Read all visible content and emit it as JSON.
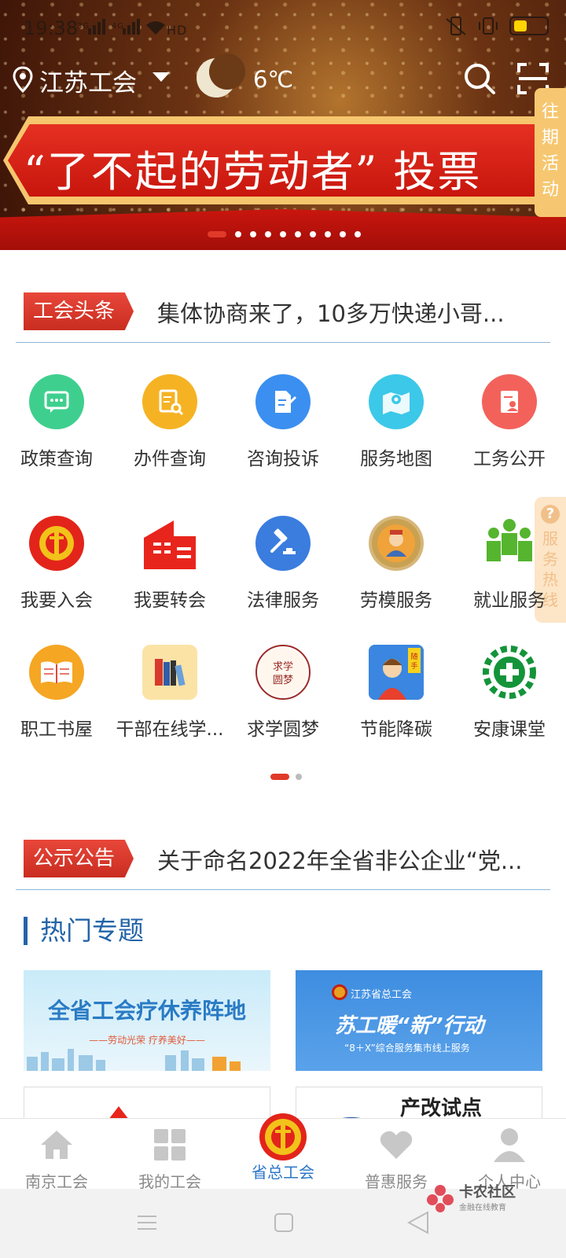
{
  "status_bar": {
    "time": "19:38",
    "network": "3G 4G HD"
  },
  "header": {
    "location": "江苏工会",
    "temperature": "6℃"
  },
  "banner": {
    "text": "“了不起的劳动者” 投票",
    "slide_count": 10,
    "active_slide": 1
  },
  "side_tabs": {
    "past_events": "往期活动",
    "hotline": "服务热线",
    "hotline_icon": "?"
  },
  "news_strip_1": {
    "tag": "工会头条",
    "text": "集体协商来了，10多万快递小哥..."
  },
  "grid": {
    "row1": [
      {
        "label": "政策查询",
        "icon": "chat-icon",
        "color": "#3ecf8e"
      },
      {
        "label": "办件查询",
        "icon": "doc-search-icon",
        "color": "#f5b324"
      },
      {
        "label": "咨询投诉",
        "icon": "edit-doc-icon",
        "color": "#3b8ff0"
      },
      {
        "label": "服务地图",
        "icon": "map-pin-icon",
        "color": "#3cc8e8"
      },
      {
        "label": "工务公开",
        "icon": "person-doc-icon",
        "color": "#f2625b"
      }
    ],
    "row2": [
      {
        "label": "我要入会",
        "icon": "union-logo-icon"
      },
      {
        "label": "我要转会",
        "icon": "building-icon"
      },
      {
        "label": "法律服务",
        "icon": "gavel-icon"
      },
      {
        "label": "劳模服务",
        "icon": "medal-icon"
      },
      {
        "label": "就业服务",
        "icon": "people-icon"
      }
    ],
    "row3": [
      {
        "label": "职工书屋",
        "icon": "book-icon"
      },
      {
        "label": "干部在线学...",
        "icon": "books-icon"
      },
      {
        "label": "求学圆梦",
        "icon": "study-dream-icon",
        "badge": "求学圆梦"
      },
      {
        "label": "节能降碳",
        "icon": "photo-person-icon",
        "badge": "随手拍"
      },
      {
        "label": "安康课堂",
        "icon": "green-cross-icon"
      }
    ]
  },
  "news_strip_2": {
    "tag": "公示公告",
    "text": "关于命名2022年全省非公企业“党..."
  },
  "hot_topics": {
    "title": "热门专题",
    "cards": [
      {
        "title": "全省工会疗休养阵地",
        "subtitle": "——劳动光荣  疗养美好——"
      },
      {
        "org": "江苏省总工会",
        "title": "苏工暖“新”行动",
        "subtitle": "“8＋X”综合服务集市线上服务"
      },
      {
        "title": ""
      },
      {
        "title": "产改试点"
      }
    ]
  },
  "bottom_nav": [
    {
      "label": "南京工会",
      "icon": "home-icon",
      "active": false
    },
    {
      "label": "我的工会",
      "icon": "grid-icon",
      "active": false
    },
    {
      "label": "省总工会",
      "icon": "union-logo-icon",
      "active": true
    },
    {
      "label": "普惠服务",
      "icon": "heart-icon",
      "active": false
    },
    {
      "label": "个人中心",
      "icon": "person-icon",
      "active": false
    }
  ],
  "watermark": {
    "title": "卡农社区",
    "subtitle": "金融在线教育"
  },
  "colors": {
    "accent_red": "#e03a2a",
    "nav_active": "#2d77c8",
    "section_blue": "#2364a8"
  }
}
